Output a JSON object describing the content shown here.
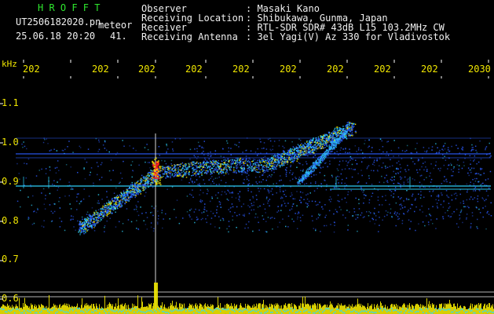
{
  "header": {
    "app_name": "H R O F F T",
    "filename": "UT2506182020.pn",
    "filename_suffix": "meteor",
    "datetime": "25.06.18 20:20",
    "frame": "41."
  },
  "info": {
    "labels": [
      "Observer",
      "Receiving Location",
      "Receiver",
      "Receiving Antenna"
    ],
    "values": [
      ": Masaki Kano",
      ": Shibukawa, Gunma, Japan",
      ": RTL-SDR SDR# 43dB L15 103.2MHz CW",
      ": 3el Yagi(V) Az 330 for Vladivostok"
    ]
  },
  "plot": {
    "y_unit": "kHz",
    "y_ticks": [
      "1.1",
      "1.0",
      "0.9",
      "0.8",
      "0.7",
      "0.6"
    ],
    "x_ticks": [
      "202",
      "202",
      "202",
      "202",
      "202",
      "202",
      "202",
      "202",
      "202",
      "2030"
    ],
    "colors": {
      "signal_blue": "#2c5cff",
      "signal_cyan": "#2fd6ff",
      "signal_yellow": "#f0e600",
      "signal_red": "#ff2020",
      "text_yellow": "#f0e600",
      "title_green": "#2ee62e",
      "baseline_cyan": "#30d8ff"
    }
  }
}
